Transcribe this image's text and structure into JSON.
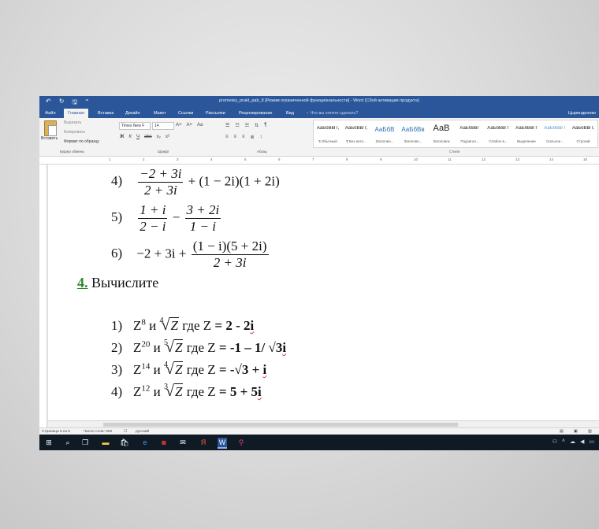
{
  "window": {
    "title": "prometey_prakt_pab_8 [Режим ограниченной функциональности] - Word (Сбой активации продукта)"
  },
  "quick_access": {
    "undo": "↶",
    "redo": "↻",
    "save": "🖫",
    "more": "⁼"
  },
  "menu": {
    "tabs": [
      "Файл",
      "Главная",
      "Вставка",
      "Дизайн",
      "Макет",
      "Ссылки",
      "Рассылки",
      "Рецензирование",
      "Вид"
    ],
    "active_index": 1,
    "tell_me": "♀ Что вы хотите сделать?",
    "user": "Цыренденоко"
  },
  "ribbon": {
    "clipboard": {
      "paste": "Вставить",
      "cut": "Вырезать",
      "copy": "Копировать",
      "format_painter": "Формат по образцу",
      "group": "Буфер обмена"
    },
    "font": {
      "name": "Times New F",
      "size": "14",
      "group": "Шрифт",
      "grow": "A˄",
      "shrink": "A˅",
      "case": "Aa",
      "bold": "Ж",
      "italic": "К",
      "underline": "Ч",
      "strike": "abc",
      "sub": "x₂",
      "sup": "x²"
    },
    "paragraph": {
      "group": "Абзац"
    },
    "styles": {
      "group": "Стили",
      "items": [
        {
          "sample": "АаБбВвГг,",
          "name": "¶ Обычный"
        },
        {
          "sample": "АаБбВвГг,",
          "name": "¶ Без инте..."
        },
        {
          "sample": "АаБбВ",
          "name": "Заголово..."
        },
        {
          "sample": "АаБбВв",
          "name": "Заголово..."
        },
        {
          "sample": "АаВ",
          "name": "Заголовок"
        },
        {
          "sample": "АаБбВвГ",
          "name": "Подзагол..."
        },
        {
          "sample": "АаБбВвГг",
          "name": "Слабое в..."
        },
        {
          "sample": "АаБбВвГг",
          "name": "Выделение"
        },
        {
          "sample": "АаБбВвГг",
          "name": "Сильное..."
        },
        {
          "sample": "АаБбВвГг,",
          "name": "Строгий"
        }
      ]
    }
  },
  "ruler": {
    "marks": [
      "1",
      "2",
      "3",
      "4",
      "5",
      "6",
      "7",
      "8",
      "9",
      "10",
      "11",
      "12",
      "13",
      "14",
      "15"
    ]
  },
  "document": {
    "prev_items": [
      {
        "n": "4)",
        "num": "−2 + 3i",
        "den": "2 + 3i",
        "rest": "+ (1 − 2i)(1 + 2i)"
      },
      {
        "n": "5)",
        "num1": "1 + i",
        "den1": "2 − i",
        "op": "−",
        "num2": "3 + 2i",
        "den2": "1 − i"
      },
      {
        "n": "6)",
        "lead": "−2 + 3i +",
        "num": "(1 − i)(5 + 2i)",
        "den": "2 + 3i"
      }
    ],
    "heading": {
      "number": "4.",
      "text": " Вычислите"
    },
    "items": [
      {
        "n": "1)",
        "base": "Z",
        "pow": "8",
        "and": "и",
        "root_idx": "4",
        "root_var": "Z",
        "where": "где Z",
        "value": "= 2 - 2",
        "tail": "i"
      },
      {
        "n": "2)",
        "base": "Z",
        "pow": "20",
        "and": "и",
        "root_idx": "5",
        "root_var": "Z",
        "where": "где Z",
        "value": "= -1 – 1/ √3",
        "tail": "i"
      },
      {
        "n": "3)",
        "base": "Z",
        "pow": "14",
        "and": "и",
        "root_idx": "4",
        "root_var": "Z",
        "where": "где Z",
        "value": "= -√3 + ",
        "tail": "i"
      },
      {
        "n": "4)",
        "base": "Z",
        "pow": "12",
        "and": "и",
        "root_idx": "3",
        "root_var": "Z",
        "where": "где Z",
        "value": "= 5 + 5",
        "tail": "i"
      }
    ]
  },
  "status": {
    "page": "Страница 5 из 5",
    "words": "Число слов: 592",
    "lang": "русский"
  },
  "taskbar": {
    "icons": [
      "windows-start",
      "search",
      "task-view",
      "explorer",
      "store",
      "edge",
      "mcafee",
      "mail",
      "yandex",
      "word",
      "maps"
    ]
  },
  "colors": {
    "word_blue": "#2b579a",
    "heading_green": "#2a8a2a",
    "taskbar": "#101a24"
  }
}
